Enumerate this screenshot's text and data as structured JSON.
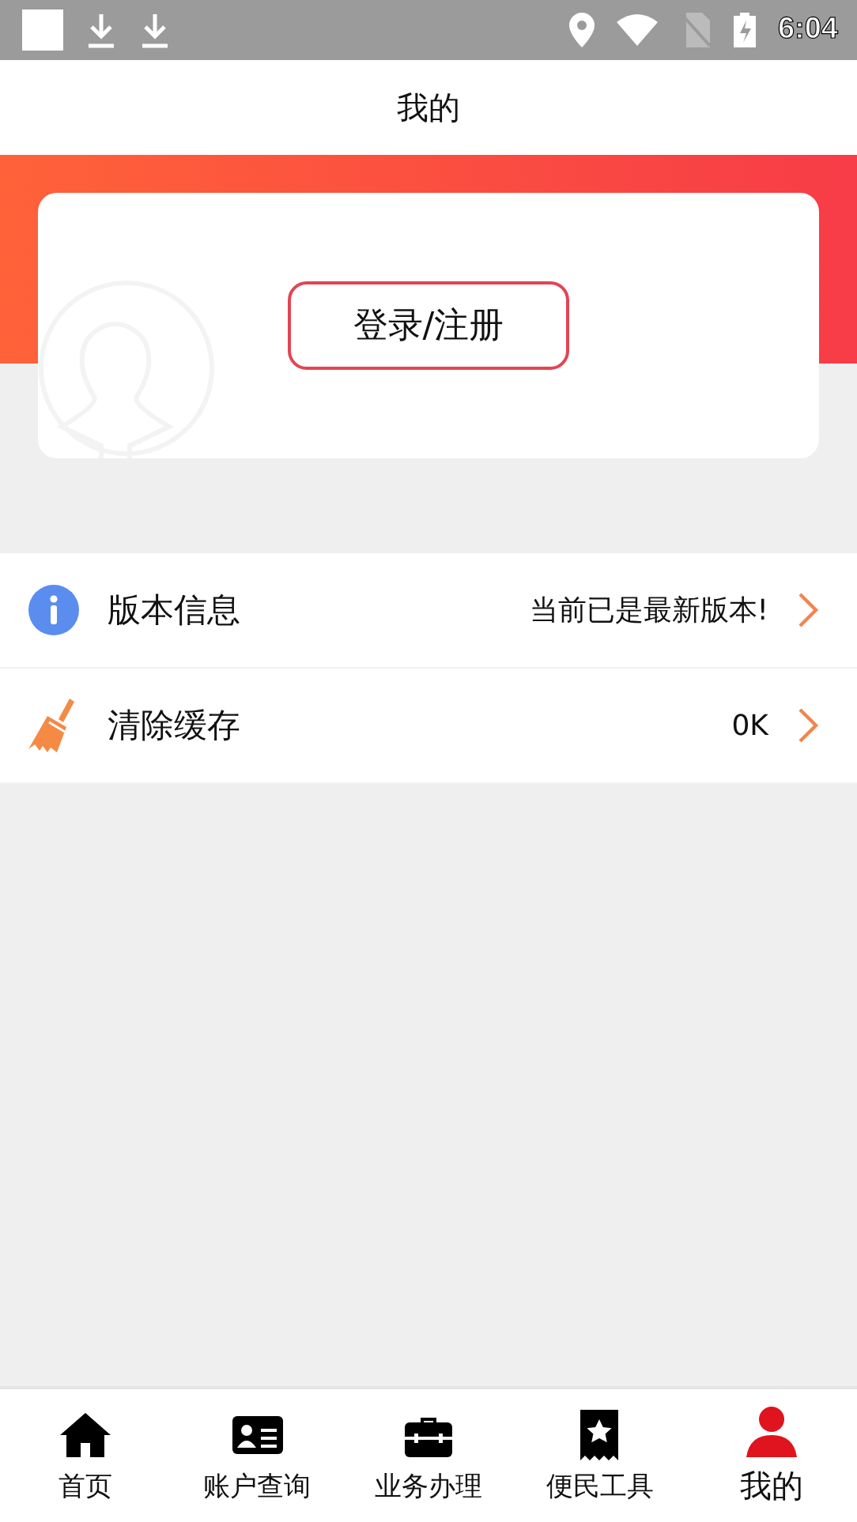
{
  "status_bar": {
    "time": "6:04"
  },
  "header": {
    "title": "我的"
  },
  "profile": {
    "login_button": "登录/注册"
  },
  "settings": [
    {
      "kind": "info",
      "label": "版本信息",
      "value": "当前已是最新版本!"
    },
    {
      "kind": "broom",
      "label": "清除缓存",
      "value": "0K"
    }
  ],
  "tabs": [
    {
      "kind": "home",
      "label": "首页",
      "selected": false
    },
    {
      "kind": "card",
      "label": "账户查询",
      "selected": false
    },
    {
      "kind": "briefcase",
      "label": "业务办理",
      "selected": false
    },
    {
      "kind": "bookmark",
      "label": "便民工具",
      "selected": false
    },
    {
      "kind": "person",
      "label": "我的",
      "selected": true
    }
  ]
}
